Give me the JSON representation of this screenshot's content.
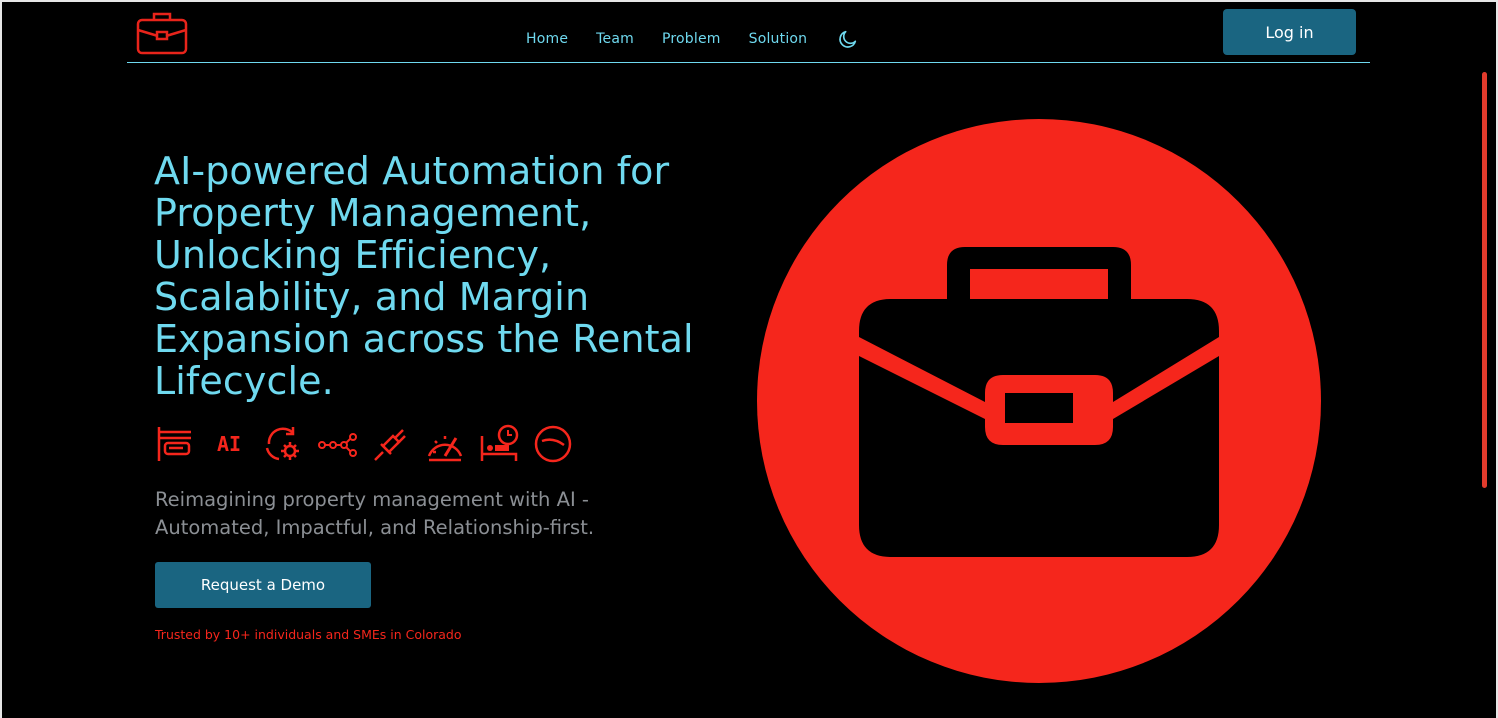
{
  "nav": {
    "logo_icon": "briefcase-icon",
    "links": [
      "Home",
      "Team",
      "Problem",
      "Solution"
    ],
    "theme_toggle_icon": "moon-icon",
    "login_label": "Log in"
  },
  "hero": {
    "headline": "AI-powered Automation for Property Management, Unlocking Efficiency, Scalability, and Margin Expansion across the Rental Lifecycle.",
    "feature_icons": [
      "screen-icon",
      "ai-icon",
      "refresh-settings-icon",
      "workflow-icon",
      "plug-icon",
      "speedometer-icon",
      "bed-clock-icon",
      "gauge-icon"
    ],
    "subtitle": "Reimagining property management with AI - Automated, Impactful, and Relationship-first.",
    "cta_label": "Request a Demo",
    "trusted_text": "Trusted by 10+ individuals and SMEs in Colorado",
    "illustration_icon": "briefcase-icon"
  },
  "colors": {
    "accent_cyan": "#6fd9ef",
    "brand_red": "#f5261c",
    "button_blue": "#1a6581",
    "background": "#000000"
  }
}
